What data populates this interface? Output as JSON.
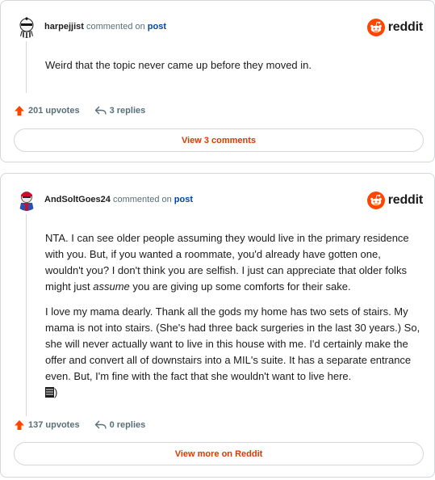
{
  "brand": {
    "name": "reddit",
    "icon": "reddit-logo-icon",
    "accent_color": "#ff4500"
  },
  "comments": [
    {
      "username": "harpejjist",
      "commented_on": "commented on",
      "post_link": "post",
      "paragraphs": [
        "Weird that the topic never came up before they moved in."
      ],
      "upvotes": "201 upvotes",
      "replies": "3 replies",
      "button": "View 3 comments"
    },
    {
      "username": "AndSoltGoes24",
      "commented_on": "commented on",
      "post_link": "post",
      "paragraph1_before": "NTA. I can see older people assuming they would live in the primary residence with you. But, if you wanted a roommate, you'd already have gotten one, wouldn't you? I don't think you are selfish. I just can appreciate that older folks might just ",
      "paragraph1_emphasis": "assume",
      "paragraph1_after": " you are giving up some comforts for their sake.",
      "paragraph2": "I love my mama dearly. Thank all the gods my home has two sets of stairs. My mama is not into stairs. (She's had three back surgeries in the last 30 years.) So, she will never actually want to live in this house with me. I'd certainly make the offer and convert all of downstairs into a MIL's suite. It has a separate entrance even. But, I'm fine with the fact that she wouldn't want to live here.",
      "paragraph2_tail": ")",
      "upvotes": "137 upvotes",
      "replies": "0 replies",
      "button": "View more on Reddit"
    }
  ],
  "colors": {
    "upvote": "#ff4500",
    "link": "#0045ac",
    "button_text": "#d93a00",
    "muted": "#576f76"
  }
}
